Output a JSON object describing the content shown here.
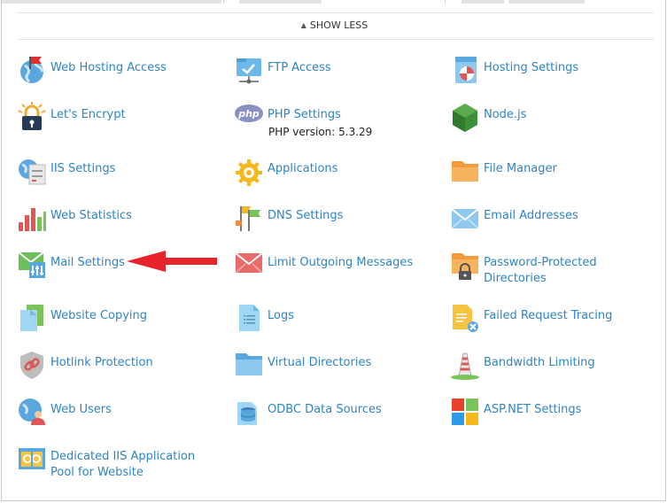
{
  "toggle": {
    "label": "SHOW LESS"
  },
  "items": [
    {
      "label": "Web Hosting Access",
      "icon": "globe-flag-icon"
    },
    {
      "label": "FTP Access",
      "icon": "ftp-folder-icon"
    },
    {
      "label": "Hosting Settings",
      "icon": "hosting-settings-icon"
    },
    {
      "label": "Let's Encrypt",
      "icon": "lock-icon"
    },
    {
      "label": "PHP Settings",
      "icon": "php-icon",
      "sub": "PHP version: 5.3.29"
    },
    {
      "label": "Node.js",
      "icon": "nodejs-icon"
    },
    {
      "label": "IIS Settings",
      "icon": "iis-server-icon"
    },
    {
      "label": "Applications",
      "icon": "gear-icon"
    },
    {
      "label": "File Manager",
      "icon": "folder-icon"
    },
    {
      "label": "Web Statistics",
      "icon": "bar-chart-icon"
    },
    {
      "label": "DNS Settings",
      "icon": "dns-flags-icon"
    },
    {
      "label": "Email Addresses",
      "icon": "envelope-icon"
    },
    {
      "label": "Mail Settings",
      "icon": "mail-settings-icon"
    },
    {
      "label": "Limit Outgoing Messages",
      "icon": "envelope-red-icon"
    },
    {
      "label": "Password-Protected Directories",
      "icon": "locked-folder-icon"
    },
    {
      "label": "Website Copying",
      "icon": "copy-icon"
    },
    {
      "label": "Logs",
      "icon": "log-file-icon"
    },
    {
      "label": "Failed Request Tracing",
      "icon": "failed-trace-icon"
    },
    {
      "label": "Hotlink Protection",
      "icon": "shield-link-icon"
    },
    {
      "label": "Virtual Directories",
      "icon": "virtual-folder-icon"
    },
    {
      "label": "Bandwidth Limiting",
      "icon": "tower-icon"
    },
    {
      "label": "Web Users",
      "icon": "web-users-icon"
    },
    {
      "label": "ODBC Data Sources",
      "icon": "database-icon"
    },
    {
      "label": "ASP.NET Settings",
      "icon": "aspnet-icon"
    },
    {
      "label": "Dedicated IIS Application Pool for Website",
      "icon": "app-pool-icon"
    }
  ],
  "colors": {
    "link": "#2e84c2",
    "annotation_arrow": "#e8222a"
  }
}
